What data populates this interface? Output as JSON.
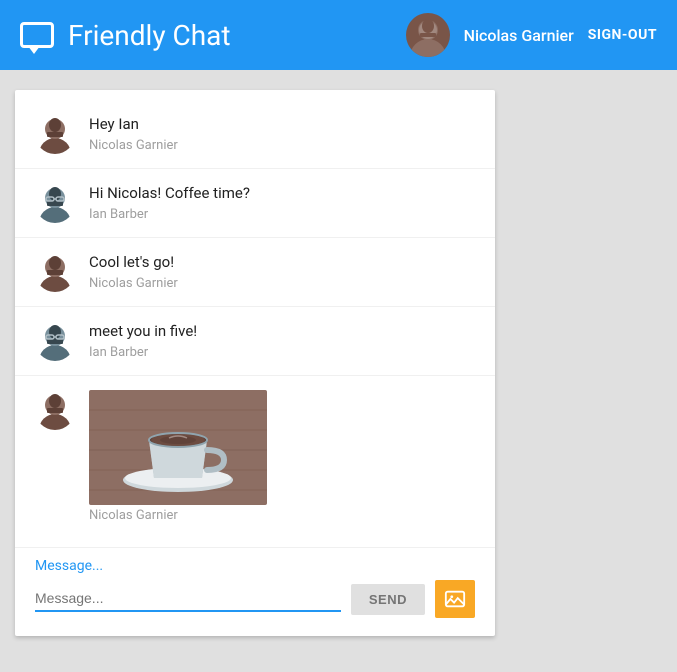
{
  "header": {
    "title": "Friendly Chat",
    "user_name": "Nicolas Garnier",
    "sign_out_label": "SIGN-OUT"
  },
  "messages": [
    {
      "id": 1,
      "text": "Hey Ian",
      "sender": "Nicolas Garnier",
      "avatar_type": "nicolas",
      "type": "text"
    },
    {
      "id": 2,
      "text": "Hi Nicolas! Coffee time?",
      "sender": "Ian Barber",
      "avatar_type": "ian",
      "type": "text"
    },
    {
      "id": 3,
      "text": "Cool let's go!",
      "sender": "Nicolas Garnier",
      "avatar_type": "nicolas",
      "type": "text"
    },
    {
      "id": 4,
      "text": "meet you in five!",
      "sender": "Ian Barber",
      "avatar_type": "ian",
      "type": "text"
    },
    {
      "id": 5,
      "text": "",
      "sender": "Nicolas Garnier",
      "avatar_type": "nicolas",
      "type": "image"
    }
  ],
  "input": {
    "label": "Message...",
    "placeholder": "Message...",
    "send_button_label": "SEND"
  }
}
